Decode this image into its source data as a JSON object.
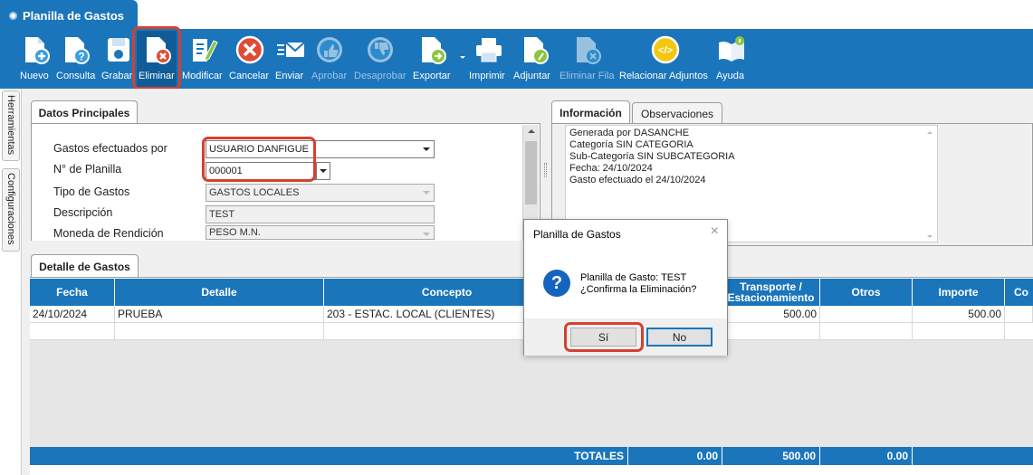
{
  "window": {
    "title": "Planilla de Gastos"
  },
  "toolbar": {
    "items": [
      {
        "label": "Nuevo",
        "icon": "new-doc-icon",
        "enabled": true
      },
      {
        "label": "Consulta",
        "icon": "query-doc-icon",
        "enabled": true
      },
      {
        "label": "Grabar",
        "icon": "save-disk-icon",
        "enabled": true
      },
      {
        "label": "Eliminar",
        "icon": "delete-doc-icon",
        "enabled": true,
        "selected": true
      },
      {
        "label": "Modificar",
        "icon": "edit-doc-icon",
        "enabled": true
      },
      {
        "label": "Cancelar",
        "icon": "cancel-circle-icon",
        "enabled": true
      },
      {
        "label": "Enviar",
        "icon": "send-mail-icon",
        "enabled": true
      },
      {
        "label": "Aprobar",
        "icon": "thumbs-up-icon",
        "enabled": false
      },
      {
        "label": "Desaprobar",
        "icon": "thumbs-down-icon",
        "enabled": false
      },
      {
        "label": "Exportar",
        "icon": "export-doc-icon",
        "enabled": true
      },
      {
        "label": "Imprimir",
        "icon": "printer-icon",
        "enabled": true
      },
      {
        "label": "Adjuntar",
        "icon": "attach-doc-icon",
        "enabled": true
      },
      {
        "label": "Eliminar Fila",
        "icon": "delete-row-icon",
        "enabled": false
      },
      {
        "label": "Relacionar Adjuntos",
        "icon": "link-attachments-icon",
        "enabled": true
      },
      {
        "label": "Ayuda",
        "icon": "help-book-icon",
        "enabled": true
      }
    ]
  },
  "sidebar": {
    "tabs": [
      "Herramientas",
      "Configuraciones"
    ]
  },
  "datos_principales": {
    "tab_label": "Datos Principales",
    "fields": [
      {
        "label": "Gastos efectuados por",
        "value": "USUARIO DANFIGUE"
      },
      {
        "label": "N° de Planilla",
        "value": "000001"
      },
      {
        "label": "Tipo de Gastos",
        "value": "GASTOS LOCALES"
      },
      {
        "label": "Descripción",
        "value": "TEST"
      },
      {
        "label": "Moneda de Rendición",
        "value": "PESO M.N."
      }
    ]
  },
  "info": {
    "tabs": [
      "Información",
      "Observaciones"
    ],
    "lines": [
      "Generada por DASANCHE",
      "Categoría SIN CATEGORIA",
      "Sub-Categoría SIN SUBCATEGORIA",
      "Fecha: 24/10/2024",
      "Gasto efectuado el 24/10/2024"
    ]
  },
  "detalle": {
    "tab_label": "Detalle de Gastos",
    "columns": [
      "Fecha",
      "Detalle",
      "Concepto",
      "Transporte / Estacionamiento",
      "Otros",
      "Importe",
      "Co"
    ],
    "rows": [
      {
        "fecha": "24/10/2024",
        "detalle": "PRUEBA",
        "concepto": "203 - ESTAC. LOCAL (CLIENTES)",
        "transporte": "500.00",
        "otros": "",
        "importe": "500.00"
      }
    ],
    "totals": {
      "label": "TOTALES",
      "t1": "0.00",
      "t2": "500.00",
      "t3": "0.00"
    }
  },
  "dialog": {
    "title": "Planilla de Gastos",
    "line1": "Planilla de Gasto: TEST",
    "line2": "¿Confirma la Eliminación?",
    "yes_label": "Sí",
    "no_label": "No",
    "close_glyph": "×",
    "question_glyph": "?"
  },
  "colors": {
    "brand": "#1b75bb",
    "highlight": "#d5402f"
  }
}
